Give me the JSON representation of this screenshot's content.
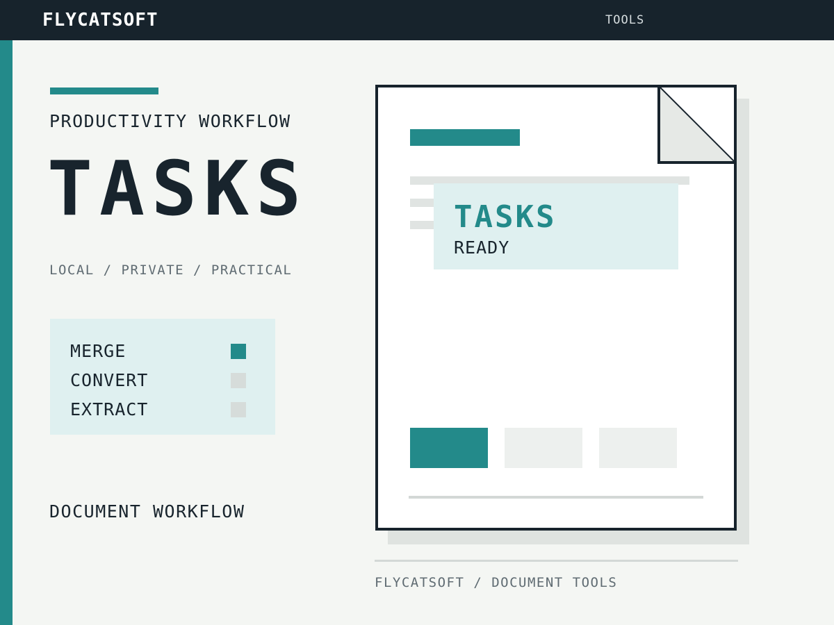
{
  "header": {
    "brand": "FLYCATSOFT",
    "nav_tools": "TOOLS"
  },
  "hero": {
    "eyebrow": "PRODUCTIVITY WORKFLOW",
    "title": "TASKS",
    "tagline": "LOCAL / PRIVATE / PRACTICAL"
  },
  "task_panel": {
    "items": [
      {
        "label": "MERGE",
        "active": true
      },
      {
        "label": "CONVERT",
        "active": false
      },
      {
        "label": "EXTRACT",
        "active": false
      }
    ]
  },
  "section_label": "DOCUMENT WORKFLOW",
  "document": {
    "card_title": "TASKS",
    "card_status": "READY"
  },
  "footer": {
    "text": "FLYCATSOFT / DOCUMENT TOOLS"
  },
  "colors": {
    "accent": "#238a8a",
    "dark": "#17232c",
    "panel": "#dff0f0",
    "background": "#f4f6f3"
  }
}
